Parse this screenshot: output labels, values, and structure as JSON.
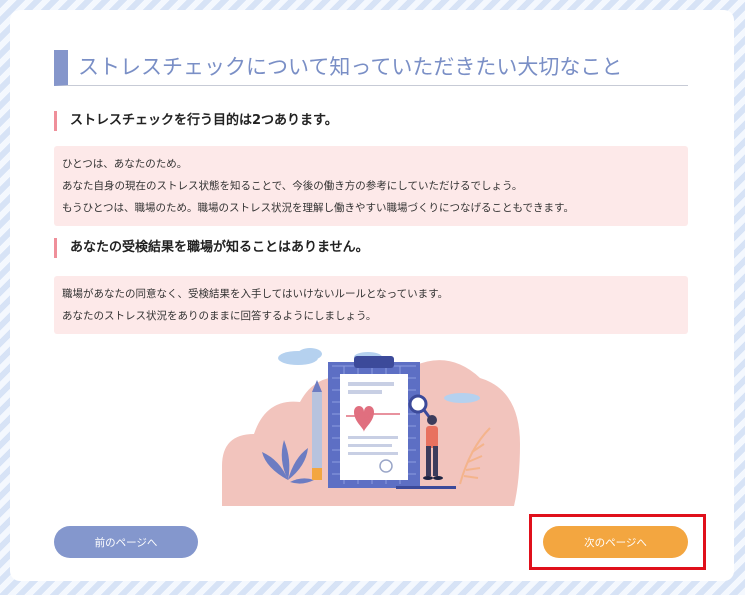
{
  "page": {
    "title": "ストレスチェックについて知っていただきたい大切なこと"
  },
  "sections": [
    {
      "heading": "ストレスチェックを行う目的は2つあります。",
      "lines": [
        "ひとつは、あなたのため。",
        "あなた自身の現在のストレス状態を知ることで、今後の働き方の参考にしていただけるでしょう。",
        "もうひとつは、職場のため。職場のストレス状況を理解し働きやすい職場づくりにつなげることもできます。"
      ]
    },
    {
      "heading": "あなたの受検結果を職場が知ることはありません。",
      "lines": [
        "職場があなたの同意なく、受検結果を入手してはいけないルールとなっています。",
        "あなたのストレス状況をありのままに回答するようにしましょう。"
      ]
    }
  ],
  "navigation": {
    "prev_label": "前のページへ",
    "next_label": "次のページへ"
  },
  "colors": {
    "accent": "#8596cb",
    "section_marker": "#ef8f9a",
    "section_background": "#fde9e9",
    "prev_button": "#8497cd",
    "next_button": "#f3a640",
    "highlight_box": "#e0101b"
  },
  "illustration": {
    "icon": "stress-check-clipboard-illustration"
  }
}
